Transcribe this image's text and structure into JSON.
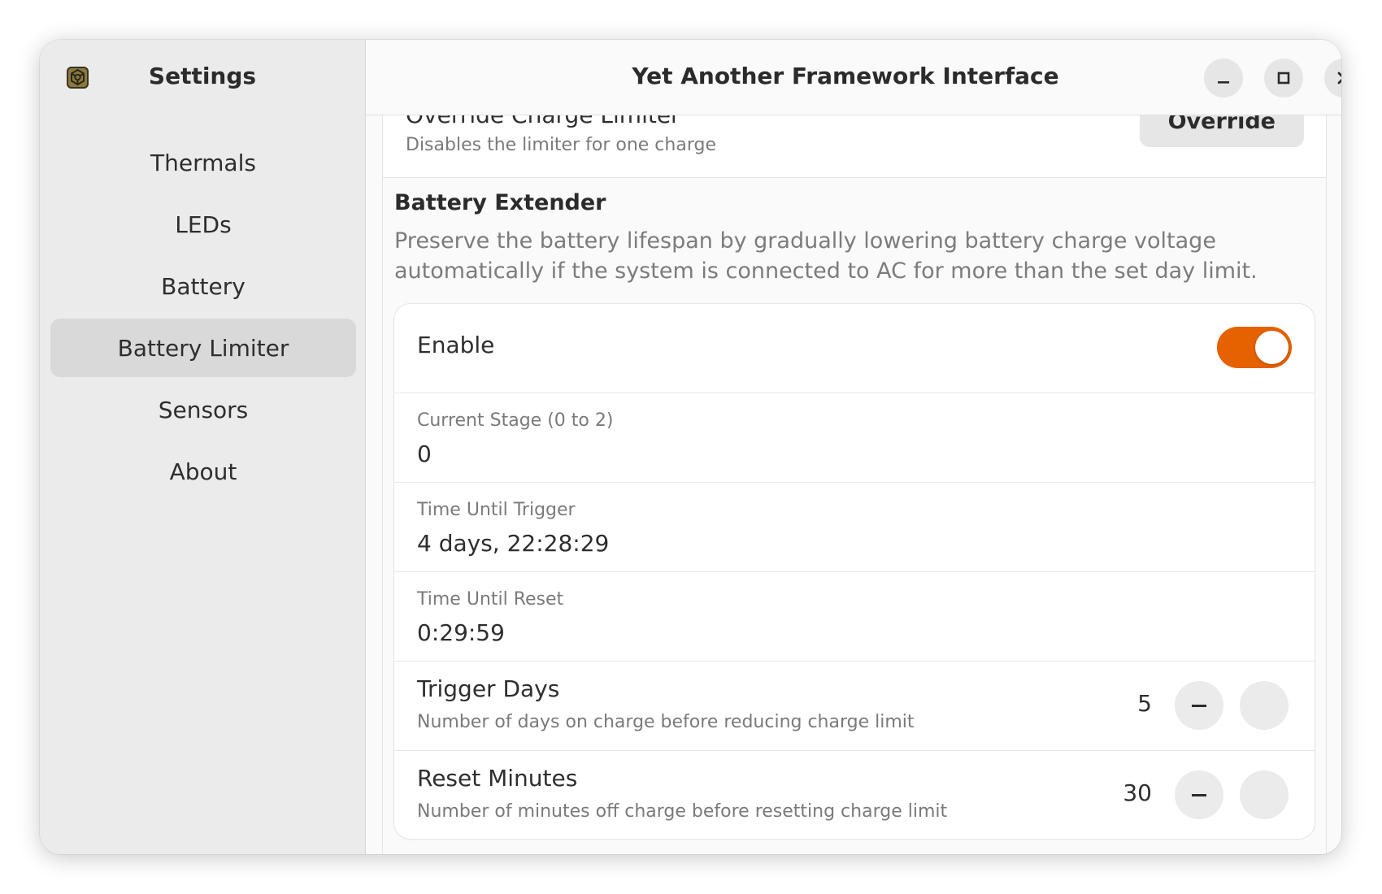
{
  "sidebar": {
    "title": "Settings",
    "items": [
      {
        "label": "Thermals",
        "active": false
      },
      {
        "label": "LEDs",
        "active": false
      },
      {
        "label": "Battery",
        "active": false
      },
      {
        "label": "Battery Limiter",
        "active": true
      },
      {
        "label": "Sensors",
        "active": false
      },
      {
        "label": "About",
        "active": false
      }
    ]
  },
  "header": {
    "title": "Yet Another Framework Interface",
    "buttons": [
      "minimize-icon",
      "maximize-icon",
      "close-icon"
    ]
  },
  "override_row": {
    "title": "Override Charge Limiter",
    "subtitle": "Disables the limiter for one charge",
    "button_label": "Override"
  },
  "battery_extender": {
    "title": "Battery Extender",
    "description": "Preserve the battery lifespan by gradually lowering battery charge voltage automatically if the system is connected to AC for more than the set day limit.",
    "enable": {
      "label": "Enable",
      "enabled": true
    },
    "current_stage": {
      "caption": "Current Stage (0 to 2)",
      "value": "0"
    },
    "time_until_trigger": {
      "caption": "Time Until Trigger",
      "value": "4 days, 22:28:29"
    },
    "time_until_reset": {
      "caption": "Time Until Reset",
      "value": "0:29:59"
    },
    "trigger_days": {
      "title": "Trigger Days",
      "subtitle": "Number of days on charge before reducing charge limit",
      "value": "5"
    },
    "reset_minutes": {
      "title": "Reset Minutes",
      "subtitle": "Number of minutes off charge before resetting charge limit",
      "value": "30"
    }
  },
  "colors": {
    "accent": "#e66100",
    "sidebar_bg": "#ebebeb",
    "active_item_bg": "#d9d9d9"
  }
}
